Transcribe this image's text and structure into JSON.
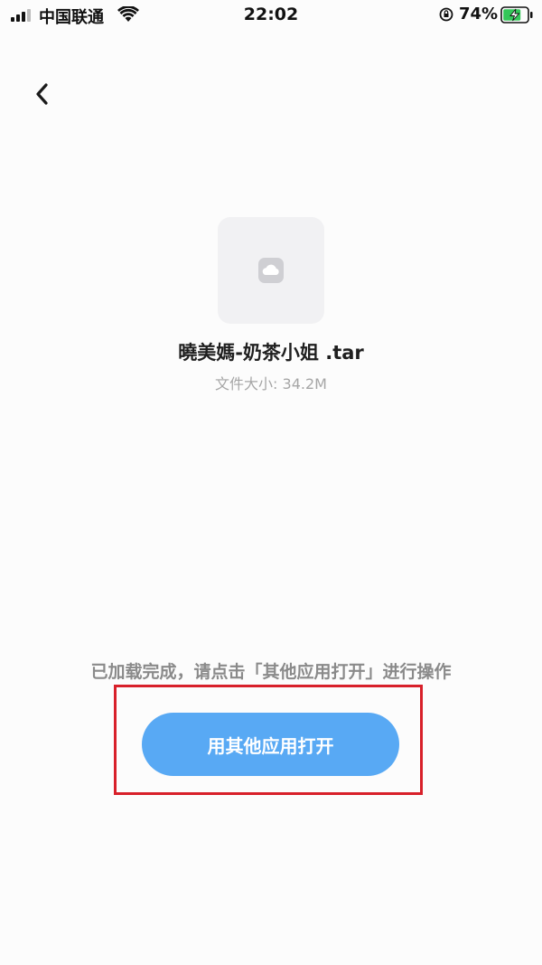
{
  "status_bar": {
    "carrier": "中国联通",
    "time": "22:02",
    "battery_percent": "74%"
  },
  "file": {
    "name": "曉美媽-奶茶小姐 .tar",
    "size_label": "文件大小: 34.2M",
    "icon": "cloud-file-icon"
  },
  "hint": "已加载完成，请点击「其他应用打开」进行操作",
  "open_button_label": "用其他应用打开",
  "colors": {
    "button": "#58a9f4",
    "highlight": "#d8202a",
    "battery": "#34c759"
  }
}
